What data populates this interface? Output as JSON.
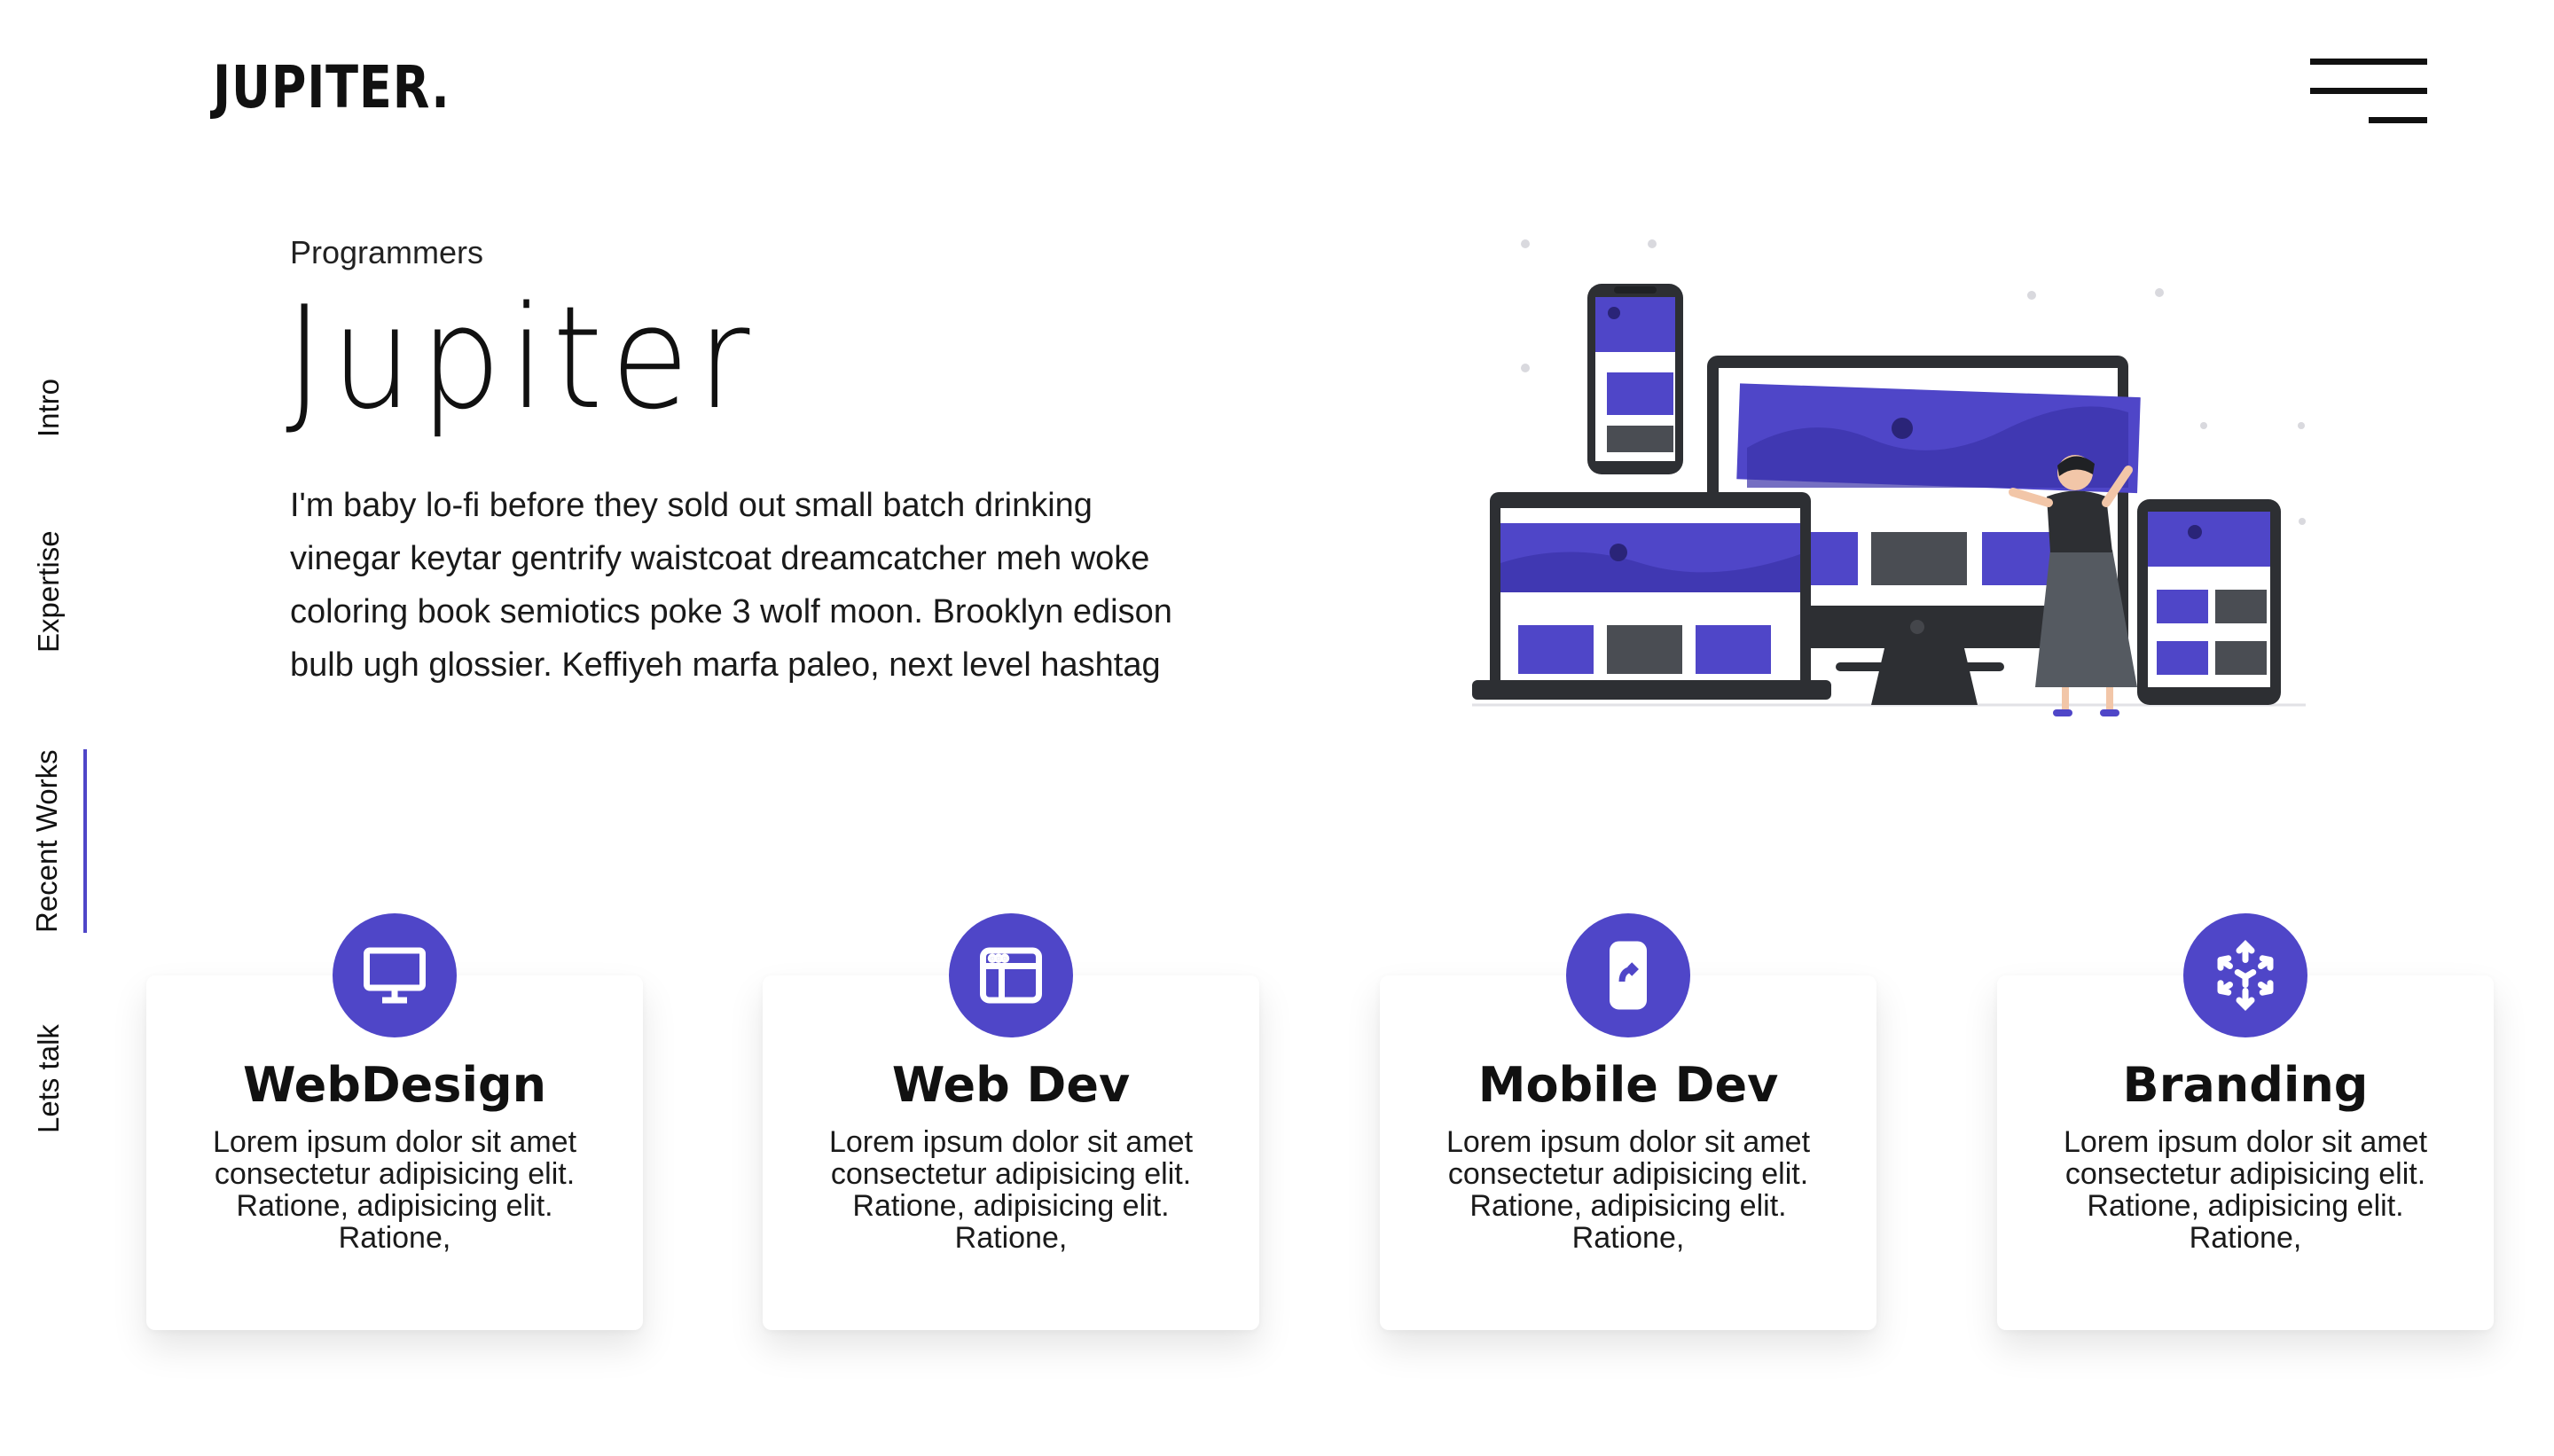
{
  "header": {
    "logo": "JUPITER.",
    "menu_icon": "hamburger-menu-icon"
  },
  "side_nav": {
    "items": [
      {
        "label": "Intro"
      },
      {
        "label": "Expertise"
      },
      {
        "label": "Recent Works",
        "active": true
      },
      {
        "label": "Lets talk"
      }
    ]
  },
  "hero": {
    "subtitle": "Programmers",
    "title": "Jupiter",
    "text": "I'm baby lo-fi before they sold out small batch drinking vinegar keytar gentrify waistcoat dreamcatcher meh woke coloring book semiotics poke 3 wolf moon. Brooklyn edison bulb ugh glossier. Keffiyeh marfa paleo, next level hashtag",
    "illustration_icon": "responsive-devices-illustration"
  },
  "services": [
    {
      "title": "WebDesign",
      "icon": "monitor-icon",
      "desc": "Lorem ipsum dolor sit amet consectetur adipisicing elit. Ratione, adipisicing elit. Ratione,"
    },
    {
      "title": "Web Dev",
      "icon": "browser-window-icon",
      "desc": "Lorem ipsum dolor sit amet consectetur adipisicing elit. Ratione, adipisicing elit. Ratione,"
    },
    {
      "title": "Mobile Dev",
      "icon": "mobile-share-icon",
      "desc": "Lorem ipsum dolor sit amet consectetur adipisicing elit. Ratione, adipisicing elit. Ratione,"
    },
    {
      "title": "Branding",
      "icon": "branding-arrows-icon",
      "desc": "Lorem ipsum dolor sit amet consectetur adipisicing elit. Ratione, adipisicing elit. Ratione,"
    }
  ],
  "colors": {
    "accent": "#4f46c8",
    "text": "#111111",
    "background": "#ffffff"
  }
}
